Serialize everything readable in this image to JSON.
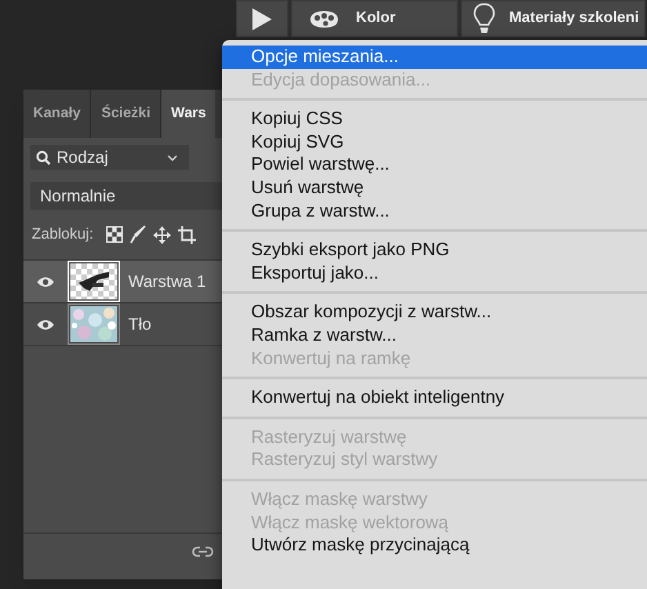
{
  "toolbar": {
    "buttons": [
      {
        "kind": "play"
      },
      {
        "kind": "palette",
        "label": "Kolor"
      },
      {
        "kind": "bulb",
        "label": "Materiały szkoleni"
      }
    ]
  },
  "layers_panel": {
    "tabs": [
      {
        "label": "Kanały",
        "selected": false
      },
      {
        "label": "Ścieżki",
        "selected": false
      },
      {
        "label": "Wars",
        "selected": true
      }
    ],
    "filter": "Rodzaj",
    "blend_mode": "Normalnie",
    "lock_label": "Zablokuj:",
    "layers": [
      {
        "name": "Warstwa 1",
        "selected": true,
        "visible": true
      },
      {
        "name": "Tło",
        "selected": false,
        "visible": true
      }
    ]
  },
  "context_menu": {
    "groups": [
      [
        {
          "label": "Opcje mieszania...",
          "selected": true,
          "disabled": false
        },
        {
          "label": "Edycja dopasowania...",
          "selected": false,
          "disabled": true
        }
      ],
      [
        {
          "label": "Kopiuj CSS",
          "selected": false,
          "disabled": false
        },
        {
          "label": "Kopiuj SVG",
          "selected": false,
          "disabled": false
        },
        {
          "label": "Powiel warstwę...",
          "selected": false,
          "disabled": false
        },
        {
          "label": "Usuń warstwę",
          "selected": false,
          "disabled": false
        },
        {
          "label": "Grupa z warstw...",
          "selected": false,
          "disabled": false
        }
      ],
      [
        {
          "label": "Szybki eksport jako PNG",
          "selected": false,
          "disabled": false
        },
        {
          "label": "Eksportuj jako...",
          "selected": false,
          "disabled": false
        }
      ],
      [
        {
          "label": "Obszar kompozycji z warstw...",
          "selected": false,
          "disabled": false
        },
        {
          "label": "Ramka z warstw...",
          "selected": false,
          "disabled": false
        },
        {
          "label": "Konwertuj na ramkę",
          "selected": false,
          "disabled": true
        }
      ],
      [
        {
          "label": "Konwertuj na obiekt inteligentny",
          "selected": false,
          "disabled": false
        }
      ],
      [
        {
          "label": "Rasteryzuj warstwę",
          "selected": false,
          "disabled": true
        },
        {
          "label": "Rasteryzuj styl warstwy",
          "selected": false,
          "disabled": true
        }
      ],
      [
        {
          "label": "Włącz maskę warstwy",
          "selected": false,
          "disabled": true
        },
        {
          "label": "Włącz maskę wektorową",
          "selected": false,
          "disabled": true
        },
        {
          "label": "Utwórz maskę przycinającą",
          "selected": false,
          "disabled": false
        }
      ]
    ]
  }
}
